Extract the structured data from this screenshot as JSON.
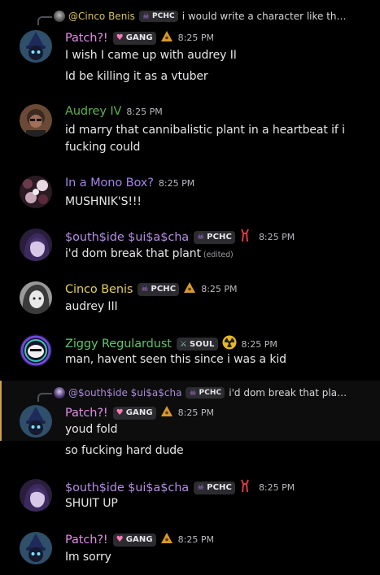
{
  "colors": {
    "patch": "#e58ce8",
    "audrey": "#5fb04f",
    "mono": "#a582e8",
    "south": "#b58ce6",
    "cinco": "#e4cf5b",
    "ziggy": "#63c56b"
  },
  "icons": {
    "gang": "heart-icon",
    "pchc": "skull-icon",
    "soul": "sword-icon",
    "pyramid": "triangle-eye-icon",
    "south_role": "red-fork-icon",
    "radioactive": "radioactive-icon"
  },
  "messages": [
    {
      "reply": {
        "author": "@Cinco Benis",
        "tag": "PCHC",
        "text": "i would write a character like th…"
      },
      "author": "Patch?!",
      "tag": "GANG",
      "time": "8:25 PM",
      "lines": [
        "I wish I came up with audrey II",
        "Id be killing it as a vtuber"
      ]
    },
    {
      "author": "Audrey IV",
      "time": "8:25 PM",
      "lines": [
        "id marry that cannibalistic plant in a heartbeat if i",
        "fucking could"
      ]
    },
    {
      "author": "In a Mono Box?",
      "time": "8:25 PM",
      "lines": [
        "MUSHNIK'S!!!"
      ]
    },
    {
      "author": "$outh$ide $ui$a$cha",
      "tag": "PCHC",
      "time": "8:25 PM",
      "lines": [
        "i'd dom break that plant"
      ],
      "edited": "(edited)"
    },
    {
      "author": "Cinco Benis",
      "tag": "PCHC",
      "time": "8:25 PM",
      "lines": [
        "audrey III"
      ]
    },
    {
      "author": "Ziggy Regulardust",
      "tag": "SOUL",
      "time": "8:25 PM",
      "lines": [
        "man, havent seen this since i was a kid"
      ]
    },
    {
      "reply": {
        "author": "@$outh$ide $ui$a$cha",
        "tag": "PCHC",
        "text": "i'd dom break that pla…"
      },
      "author": "Patch?!",
      "tag": "GANG",
      "time": "8:25 PM",
      "lines": [
        "youd fold",
        "so fucking hard dude"
      ]
    },
    {
      "author": "$outh$ide $ui$a$cha",
      "tag": "PCHC",
      "time": "8:25 PM",
      "lines": [
        "SHUIT UP"
      ]
    },
    {
      "author": "Patch?!",
      "tag": "GANG",
      "time": "8:25 PM",
      "lines": [
        "Im sorry"
      ]
    }
  ]
}
